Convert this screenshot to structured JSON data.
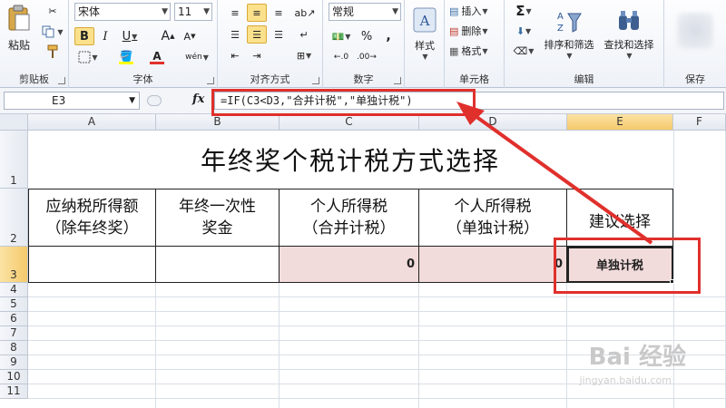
{
  "ribbon": {
    "clipboard": {
      "paste_label": "粘贴",
      "group_label": "剪贴板"
    },
    "font": {
      "family": "宋体",
      "size": "11",
      "bold": "B",
      "italic": "I",
      "underline": "U",
      "grow": "A",
      "shrink": "A",
      "font_color": "A",
      "phonetic": "wén",
      "group_label": "字体"
    },
    "alignment": {
      "group_label": "对齐方式"
    },
    "number": {
      "format": "常规",
      "percent": "%",
      "comma": ",",
      "group_label": "数字"
    },
    "styles": {
      "label": "样式"
    },
    "cells": {
      "insert": "插入",
      "delete": "删除",
      "format": "格式",
      "group_label": "单元格"
    },
    "editing": {
      "sum": "Σ",
      "sort_filter": "排序和筛选",
      "find_select": "查找和选择",
      "group_label": "编辑"
    },
    "save": {
      "group_label": "保存"
    }
  },
  "formula_bar": {
    "name_box": "E3",
    "fx": "fx",
    "formula": "=IF(C3<D3,\"合并计税\",\"单独计税\")"
  },
  "sheet": {
    "columns": [
      "A",
      "B",
      "C",
      "D",
      "E",
      "F"
    ],
    "selected_column": "E",
    "rows": [
      "1",
      "2",
      "3",
      "4",
      "5",
      "6",
      "7",
      "8",
      "9",
      "10",
      "11"
    ],
    "title": "年终奖个税计税方式选择",
    "headers": [
      [
        "应纳税所得额",
        "（除年终奖）"
      ],
      [
        "年终一次性",
        "奖金"
      ],
      [
        "个人所得税",
        "（合并计税）"
      ],
      [
        "个人所得税",
        "（单独计税）"
      ],
      [
        "建议选择"
      ]
    ],
    "row3": {
      "A": "",
      "B": "",
      "C": "0",
      "D": "0",
      "E": "单独计税"
    }
  },
  "watermark": {
    "text": "Bai 经验",
    "sub": "jingyan.baidu.com"
  },
  "colors": {
    "annotation_red": "#e0302c",
    "highlight_fill": "#f2dcdb"
  }
}
